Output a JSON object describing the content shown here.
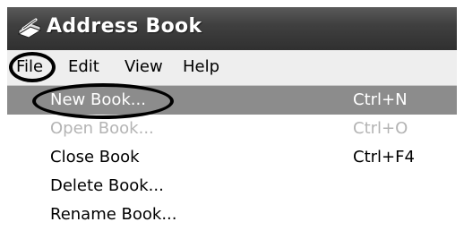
{
  "window": {
    "title": "Address Book",
    "icon": "address-book-icon"
  },
  "menubar": {
    "items": [
      {
        "label": "File"
      },
      {
        "label": "Edit"
      },
      {
        "label": "View"
      },
      {
        "label": "Help"
      }
    ]
  },
  "file_menu": {
    "items": [
      {
        "label": "New Book...",
        "shortcut": "Ctrl+N",
        "state": "highlighted"
      },
      {
        "label": "Open Book...",
        "shortcut": "Ctrl+O",
        "state": "disabled"
      },
      {
        "label": "Close Book",
        "shortcut": "Ctrl+F4",
        "state": "enabled"
      },
      {
        "label": "Delete Book...",
        "shortcut": "",
        "state": "enabled"
      },
      {
        "label": "Rename Book...",
        "shortcut": "",
        "state": "enabled"
      }
    ]
  },
  "colors": {
    "titlebar": "#404040",
    "highlight": "#8c8c8c",
    "disabled_text": "#b4b4b4"
  }
}
